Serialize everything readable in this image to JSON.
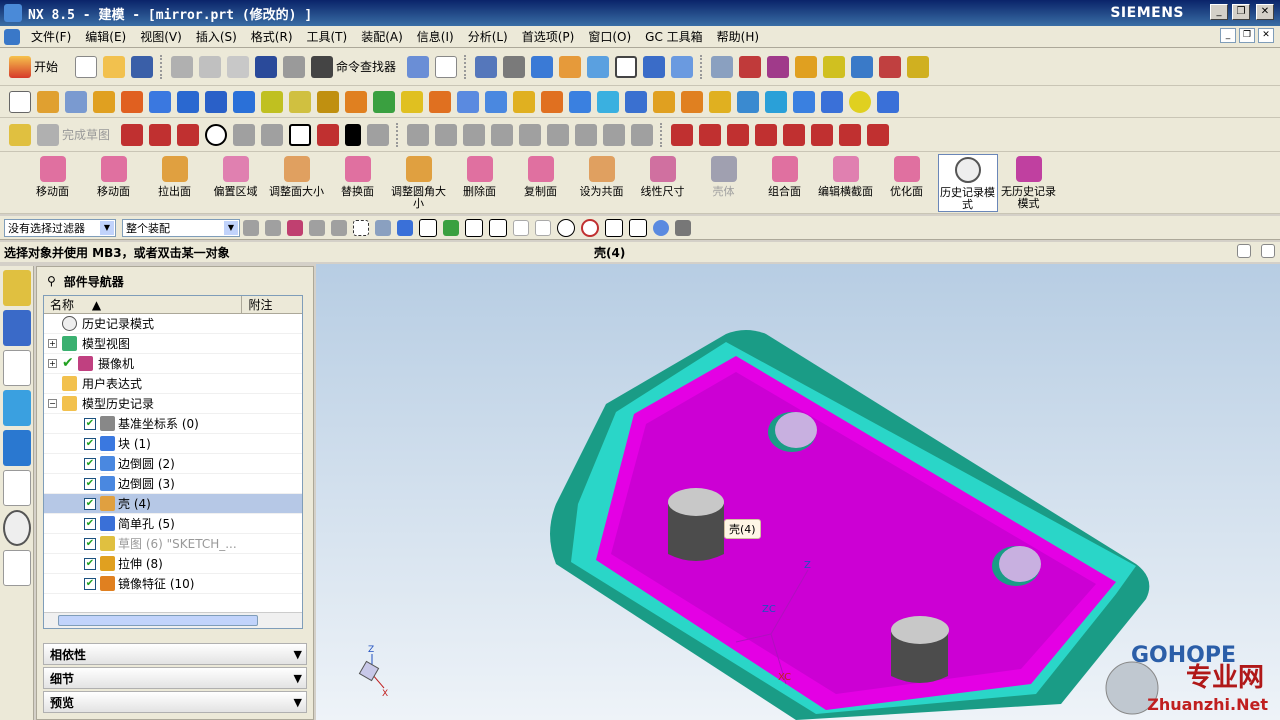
{
  "window": {
    "title": "NX 8.5 - 建模 - [mirror.prt  (修改的) ]",
    "brand": "SIEMENS"
  },
  "menubar": [
    "文件(F)",
    "编辑(E)",
    "视图(V)",
    "插入(S)",
    "格式(R)",
    "工具(T)",
    "装配(A)",
    "信息(I)",
    "分析(L)",
    "首选项(P)",
    "窗口(O)",
    "GC 工具箱",
    "帮助(H)"
  ],
  "toolbar1": {
    "start_label": "开始",
    "command_finder": "命令查找器"
  },
  "toolbar3": {
    "finish_sketch": "完成草图"
  },
  "feature_tools": [
    {
      "label": "移动面"
    },
    {
      "label": "移动面"
    },
    {
      "label": "拉出面"
    },
    {
      "label": "偏置区域"
    },
    {
      "label": "调整面大小"
    },
    {
      "label": "替换面"
    },
    {
      "label": "调整圆角大小"
    },
    {
      "label": "删除面"
    },
    {
      "label": "复制面"
    },
    {
      "label": "设为共面"
    },
    {
      "label": "线性尺寸"
    },
    {
      "label": "壳体"
    },
    {
      "label": "组合面"
    },
    {
      "label": "编辑横截面"
    },
    {
      "label": "优化面"
    },
    {
      "label": "历史记录模式"
    },
    {
      "label": "无历史记录模式"
    }
  ],
  "selection": {
    "filter": "没有选择过滤器",
    "scope": "整个装配"
  },
  "status": {
    "prompt": "选择对象并使用 MB3，或者双击某一对象",
    "selected": "壳(4)"
  },
  "navigator": {
    "title": "部件导航器",
    "col_name": "名称",
    "col_note": "附注",
    "rows": [
      {
        "label": "历史记录模式"
      },
      {
        "label": "模型视图"
      },
      {
        "label": "摄像机"
      },
      {
        "label": "用户表达式"
      },
      {
        "label": "模型历史记录"
      },
      {
        "label": "基准坐标系 (0)"
      },
      {
        "label": "块 (1)"
      },
      {
        "label": "边倒圆 (2)"
      },
      {
        "label": "边倒圆 (3)"
      },
      {
        "label": "壳 (4)"
      },
      {
        "label": "简单孔 (5)"
      },
      {
        "label": "草图 (6) \"SKETCH_..."
      },
      {
        "label": "拉伸 (8)"
      },
      {
        "label": "镜像特征 (10)"
      }
    ],
    "sections": [
      "相依性",
      "细节",
      "预览"
    ]
  },
  "viewport": {
    "tooltip": "壳(4)",
    "watermark_logo": "GOHOPE",
    "watermark_cn": "专业网",
    "watermark_url": "Zhuanzhi.Net",
    "axis_labels": {
      "z": "Z",
      "x": "X",
      "zc": "ZC",
      "xc": "XC"
    }
  }
}
